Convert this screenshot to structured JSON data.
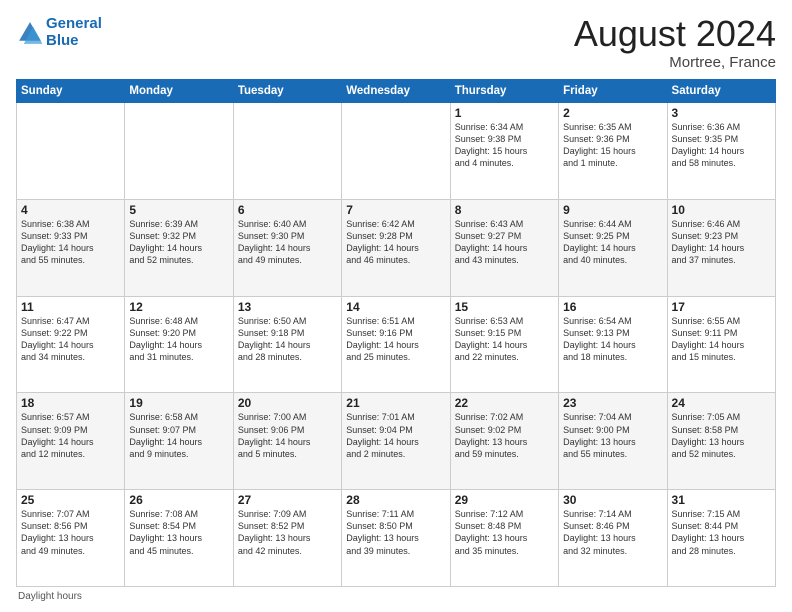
{
  "header": {
    "logo_text_general": "General",
    "logo_text_blue": "Blue",
    "month": "August 2024",
    "location": "Mortree, France"
  },
  "footer": {
    "note": "Daylight hours"
  },
  "days_of_week": [
    "Sunday",
    "Monday",
    "Tuesday",
    "Wednesday",
    "Thursday",
    "Friday",
    "Saturday"
  ],
  "weeks": [
    [
      {
        "day": "",
        "info": ""
      },
      {
        "day": "",
        "info": ""
      },
      {
        "day": "",
        "info": ""
      },
      {
        "day": "",
        "info": ""
      },
      {
        "day": "1",
        "info": "Sunrise: 6:34 AM\nSunset: 9:38 PM\nDaylight: 15 hours\nand 4 minutes."
      },
      {
        "day": "2",
        "info": "Sunrise: 6:35 AM\nSunset: 9:36 PM\nDaylight: 15 hours\nand 1 minute."
      },
      {
        "day": "3",
        "info": "Sunrise: 6:36 AM\nSunset: 9:35 PM\nDaylight: 14 hours\nand 58 minutes."
      }
    ],
    [
      {
        "day": "4",
        "info": "Sunrise: 6:38 AM\nSunset: 9:33 PM\nDaylight: 14 hours\nand 55 minutes."
      },
      {
        "day": "5",
        "info": "Sunrise: 6:39 AM\nSunset: 9:32 PM\nDaylight: 14 hours\nand 52 minutes."
      },
      {
        "day": "6",
        "info": "Sunrise: 6:40 AM\nSunset: 9:30 PM\nDaylight: 14 hours\nand 49 minutes."
      },
      {
        "day": "7",
        "info": "Sunrise: 6:42 AM\nSunset: 9:28 PM\nDaylight: 14 hours\nand 46 minutes."
      },
      {
        "day": "8",
        "info": "Sunrise: 6:43 AM\nSunset: 9:27 PM\nDaylight: 14 hours\nand 43 minutes."
      },
      {
        "day": "9",
        "info": "Sunrise: 6:44 AM\nSunset: 9:25 PM\nDaylight: 14 hours\nand 40 minutes."
      },
      {
        "day": "10",
        "info": "Sunrise: 6:46 AM\nSunset: 9:23 PM\nDaylight: 14 hours\nand 37 minutes."
      }
    ],
    [
      {
        "day": "11",
        "info": "Sunrise: 6:47 AM\nSunset: 9:22 PM\nDaylight: 14 hours\nand 34 minutes."
      },
      {
        "day": "12",
        "info": "Sunrise: 6:48 AM\nSunset: 9:20 PM\nDaylight: 14 hours\nand 31 minutes."
      },
      {
        "day": "13",
        "info": "Sunrise: 6:50 AM\nSunset: 9:18 PM\nDaylight: 14 hours\nand 28 minutes."
      },
      {
        "day": "14",
        "info": "Sunrise: 6:51 AM\nSunset: 9:16 PM\nDaylight: 14 hours\nand 25 minutes."
      },
      {
        "day": "15",
        "info": "Sunrise: 6:53 AM\nSunset: 9:15 PM\nDaylight: 14 hours\nand 22 minutes."
      },
      {
        "day": "16",
        "info": "Sunrise: 6:54 AM\nSunset: 9:13 PM\nDaylight: 14 hours\nand 18 minutes."
      },
      {
        "day": "17",
        "info": "Sunrise: 6:55 AM\nSunset: 9:11 PM\nDaylight: 14 hours\nand 15 minutes."
      }
    ],
    [
      {
        "day": "18",
        "info": "Sunrise: 6:57 AM\nSunset: 9:09 PM\nDaylight: 14 hours\nand 12 minutes."
      },
      {
        "day": "19",
        "info": "Sunrise: 6:58 AM\nSunset: 9:07 PM\nDaylight: 14 hours\nand 9 minutes."
      },
      {
        "day": "20",
        "info": "Sunrise: 7:00 AM\nSunset: 9:06 PM\nDaylight: 14 hours\nand 5 minutes."
      },
      {
        "day": "21",
        "info": "Sunrise: 7:01 AM\nSunset: 9:04 PM\nDaylight: 14 hours\nand 2 minutes."
      },
      {
        "day": "22",
        "info": "Sunrise: 7:02 AM\nSunset: 9:02 PM\nDaylight: 13 hours\nand 59 minutes."
      },
      {
        "day": "23",
        "info": "Sunrise: 7:04 AM\nSunset: 9:00 PM\nDaylight: 13 hours\nand 55 minutes."
      },
      {
        "day": "24",
        "info": "Sunrise: 7:05 AM\nSunset: 8:58 PM\nDaylight: 13 hours\nand 52 minutes."
      }
    ],
    [
      {
        "day": "25",
        "info": "Sunrise: 7:07 AM\nSunset: 8:56 PM\nDaylight: 13 hours\nand 49 minutes."
      },
      {
        "day": "26",
        "info": "Sunrise: 7:08 AM\nSunset: 8:54 PM\nDaylight: 13 hours\nand 45 minutes."
      },
      {
        "day": "27",
        "info": "Sunrise: 7:09 AM\nSunset: 8:52 PM\nDaylight: 13 hours\nand 42 minutes."
      },
      {
        "day": "28",
        "info": "Sunrise: 7:11 AM\nSunset: 8:50 PM\nDaylight: 13 hours\nand 39 minutes."
      },
      {
        "day": "29",
        "info": "Sunrise: 7:12 AM\nSunset: 8:48 PM\nDaylight: 13 hours\nand 35 minutes."
      },
      {
        "day": "30",
        "info": "Sunrise: 7:14 AM\nSunset: 8:46 PM\nDaylight: 13 hours\nand 32 minutes."
      },
      {
        "day": "31",
        "info": "Sunrise: 7:15 AM\nSunset: 8:44 PM\nDaylight: 13 hours\nand 28 minutes."
      }
    ]
  ]
}
